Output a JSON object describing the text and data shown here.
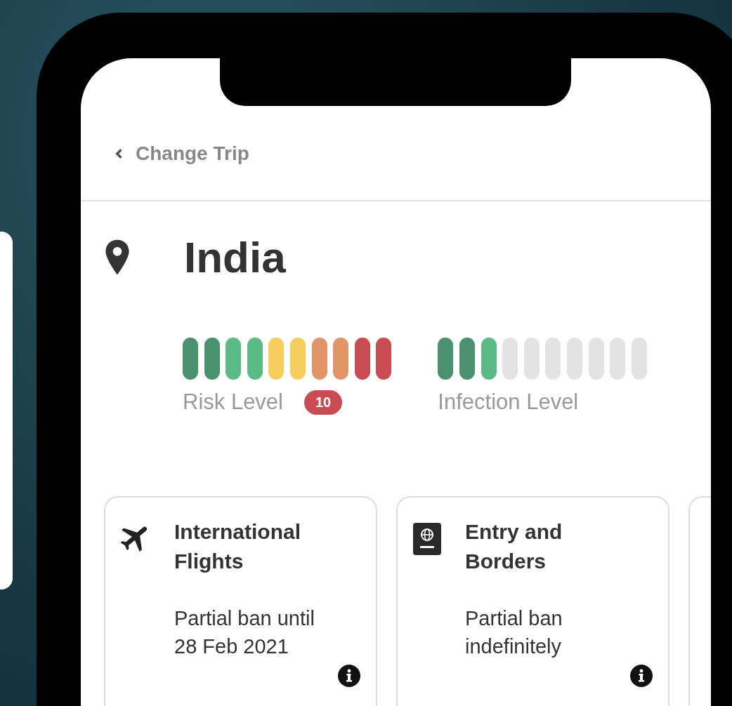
{
  "back_link": {
    "label": "Change Trip"
  },
  "destination": {
    "name": "India"
  },
  "meters": [
    {
      "label": "Risk Level",
      "level": 1.0,
      "badge": "10"
    },
    {
      "label": "Infection Level",
      "level": 0.3
    }
  ],
  "cards": [
    {
      "kind": "plane",
      "title": "International Flights",
      "text": "Partial ban until 28 Feb 2021"
    },
    {
      "kind": "passport",
      "title": "Entry and Borders",
      "text": "Partial ban indefinitely"
    }
  ]
}
